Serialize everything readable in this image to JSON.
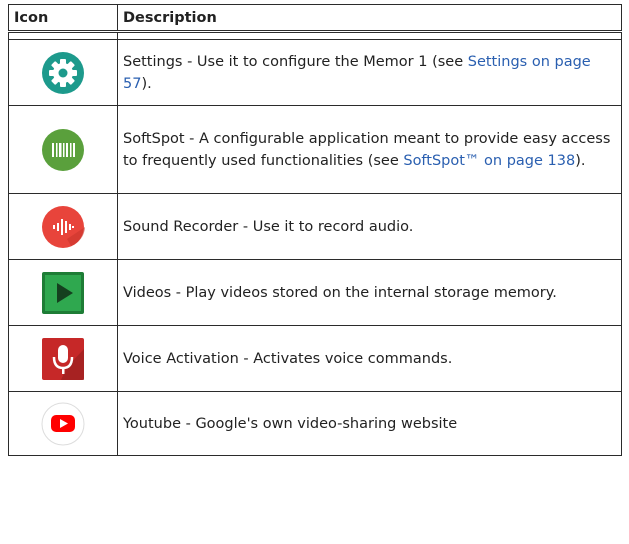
{
  "headers": {
    "icon": "Icon",
    "description": "Description"
  },
  "rows": [
    {
      "icon": "settings-gear-icon",
      "text": "Settings - Use it to configure the Memor 1 (see ",
      "link": "Settings on page 57",
      "after": ")."
    },
    {
      "icon": "softspot-barcode-icon",
      "text": "SoftSpot - A configurable application meant to provide easy access to frequently used functionalities (see ",
      "link": "SoftSpot™ on page 138",
      "after": ")."
    },
    {
      "icon": "sound-recorder-icon",
      "text": "Sound Recorder - Use it to record audio."
    },
    {
      "icon": "videos-play-icon",
      "text": "Videos - Play videos stored on the internal storage memory."
    },
    {
      "icon": "voice-activation-mic-icon",
      "text": "Voice Activation - Activates voice commands."
    },
    {
      "icon": "youtube-icon",
      "text": "Youtube - Google's own video-sharing website"
    }
  ],
  "colors": {
    "link": "#2a5fb0",
    "settings": "#1d9a8c",
    "softspot": "#5aa03c",
    "recorder": "#e8443b",
    "videos": "#2fa84f",
    "voice": "#c62828",
    "youtube": "#ff0000"
  }
}
